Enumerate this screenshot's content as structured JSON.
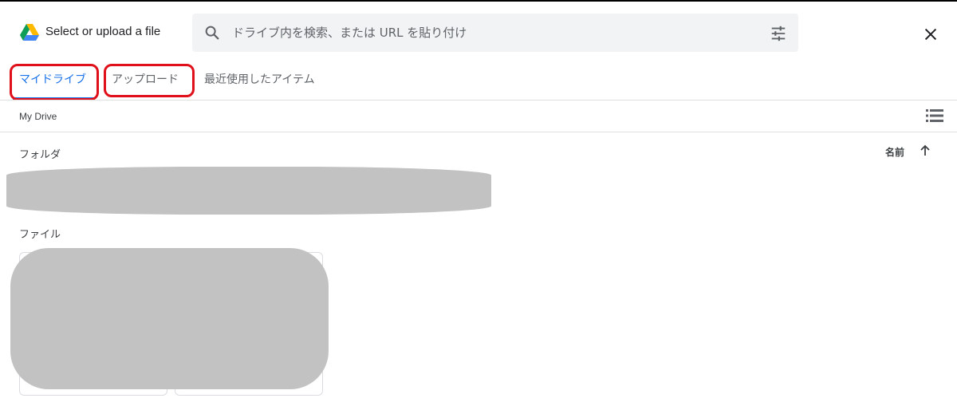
{
  "header": {
    "title": "Select or upload a file",
    "search_placeholder": "ドライブ内を検索、または URL を貼り付け"
  },
  "tabs": [
    {
      "label": "マイドライブ",
      "active": true,
      "highlighted": true
    },
    {
      "label": "アップロード",
      "active": false,
      "highlighted": true
    },
    {
      "label": "最近使用したアイテム",
      "active": false,
      "highlighted": false
    }
  ],
  "breadcrumb": "My Drive",
  "sections": {
    "folders_label": "フォルダ",
    "files_label": "ファイル"
  },
  "sort": {
    "label": "名前",
    "direction": "ascending"
  },
  "colors": {
    "accent": "#1a73e8",
    "highlight": "#e0101a",
    "redaction": "#c2c2c2"
  },
  "icons": [
    "google-drive-logo",
    "search-icon",
    "tune-icon",
    "close-icon",
    "list-view-icon",
    "arrow-up-icon"
  ]
}
